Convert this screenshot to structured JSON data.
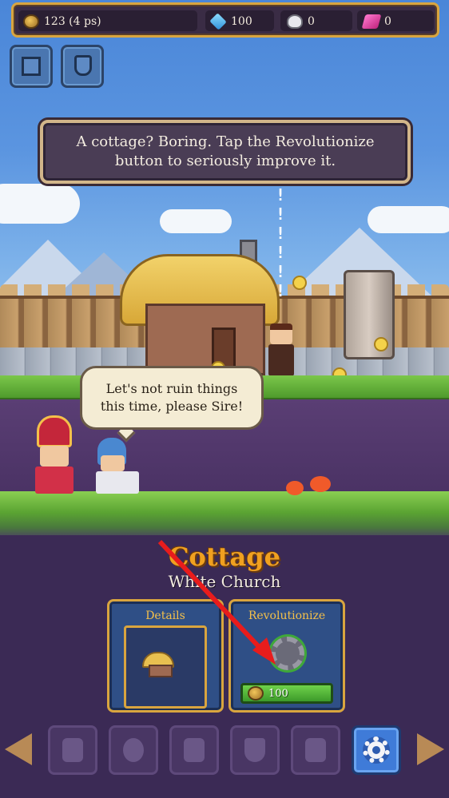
{
  "resources": {
    "coins": "123 (4 ps)",
    "gems": "100",
    "skulls": "0",
    "crystals": "0"
  },
  "top_buttons": {
    "map_icon": "map-icon",
    "trophy_icon": "trophy-scroll-icon"
  },
  "dialog": {
    "text": "A cottage? Boring. Tap the Revolutionize button to seriously improve it."
  },
  "scene": {
    "marks": "! ! ! ! ! !",
    "speech": "Let's not ruin things this time, please Sire!"
  },
  "building": {
    "name": "Cottage",
    "subtitle": "White Church"
  },
  "cards": {
    "details": {
      "title": "Details"
    },
    "revolutionize": {
      "title": "Revolutionize",
      "cost": "100"
    }
  },
  "bottom_nav": {
    "items": [
      "trophy-icon",
      "compass-icon",
      "advisor-icon",
      "shield-icon",
      "bag-icon",
      "settings-icon"
    ]
  },
  "colors": {
    "accent_gold": "#d9a53f",
    "card_blue": "#2f4f86",
    "cost_green": "#3c9a2a"
  }
}
